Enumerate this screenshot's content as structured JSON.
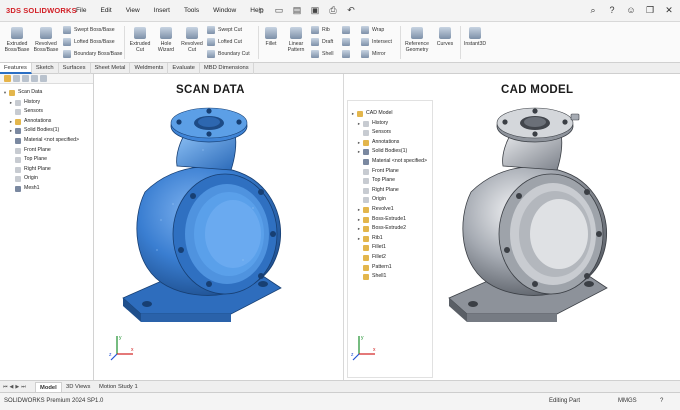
{
  "app": {
    "brand_prefix": "3DS",
    "brand": "SOLIDWORKS"
  },
  "menu": [
    "File",
    "Edit",
    "View",
    "Insert",
    "Tools",
    "Window",
    "Help"
  ],
  "quick_access_icons": [
    "home-icon",
    "new-icon",
    "open-icon",
    "save-icon",
    "print-icon",
    "undo-icon"
  ],
  "window_controls": [
    "search-icon",
    "help-icon",
    "user-icon",
    "restore-icon",
    "close-icon"
  ],
  "ribbon": {
    "extruded_boss": "Extruded Boss/Base",
    "revolved_boss": "Revolved Boss/Base",
    "swept_boss": "Swept Boss/Base",
    "lofted_boss": "Lofted Boss/Base",
    "boundary_boss": "Boundary Boss/Base",
    "extruded_cut": "Extruded Cut",
    "hole_wizard": "Hole Wizard",
    "revolved_cut": "Revolved Cut",
    "swept_cut": "Swept Cut",
    "lofted_cut": "Lofted Cut",
    "boundary_cut": "Boundary Cut",
    "fillet": "Fillet",
    "linear_pattern": "Linear Pattern",
    "rib": "Rib",
    "draft": "Draft",
    "shell": "Shell",
    "wrap": "Wrap",
    "intersect": "Intersect",
    "mirror": "Mirror",
    "reference_geometry": "Reference Geometry",
    "curves": "Curves",
    "instant3d": "Instant3D"
  },
  "tabs": [
    "Features",
    "Sketch",
    "Surfaces",
    "Sheet Metal",
    "Weldments",
    "Evaluate",
    "MBD Dimensions"
  ],
  "left_tree": {
    "root": "Scan Data",
    "items": [
      {
        "label": "History",
        "arrow": "▸",
        "icon": "w"
      },
      {
        "label": "Sensors",
        "arrow": "",
        "icon": "w"
      },
      {
        "label": "Annotations",
        "arrow": "▸",
        "icon": "y"
      },
      {
        "label": "Solid Bodies(1)",
        "arrow": "▸",
        "icon": "r"
      },
      {
        "label": "Material <not specified>",
        "arrow": "",
        "icon": "r"
      },
      {
        "label": "Front Plane",
        "arrow": "",
        "icon": "w"
      },
      {
        "label": "Top Plane",
        "arrow": "",
        "icon": "w"
      },
      {
        "label": "Right Plane",
        "arrow": "",
        "icon": "w"
      },
      {
        "label": "Origin",
        "arrow": "",
        "icon": "w"
      },
      {
        "label": "Mesh1",
        "arrow": "",
        "icon": "r"
      }
    ]
  },
  "right_tree": {
    "root": "CAD Model",
    "items": [
      {
        "label": "History",
        "arrow": "▸",
        "icon": "w"
      },
      {
        "label": "Sensors",
        "arrow": "",
        "icon": "w"
      },
      {
        "label": "Annotations",
        "arrow": "▸",
        "icon": "y"
      },
      {
        "label": "Solid Bodies(1)",
        "arrow": "▸",
        "icon": "r"
      },
      {
        "label": "Material <not specified>",
        "arrow": "",
        "icon": "r"
      },
      {
        "label": "Front Plane",
        "arrow": "",
        "icon": "w"
      },
      {
        "label": "Top Plane",
        "arrow": "",
        "icon": "w"
      },
      {
        "label": "Right Plane",
        "arrow": "",
        "icon": "w"
      },
      {
        "label": "Origin",
        "arrow": "",
        "icon": "w"
      },
      {
        "label": "Revolve1",
        "arrow": "▸",
        "icon": "y"
      },
      {
        "label": "Boss-Extrude1",
        "arrow": "▸",
        "icon": "y"
      },
      {
        "label": "Boss-Extrude2",
        "arrow": "▸",
        "icon": "y"
      },
      {
        "label": "Rib1",
        "arrow": "▸",
        "icon": "y"
      },
      {
        "label": "Fillet1",
        "arrow": "",
        "icon": "y"
      },
      {
        "label": "Fillet2",
        "arrow": "",
        "icon": "y"
      },
      {
        "label": "Pattern1",
        "arrow": "",
        "icon": "y"
      },
      {
        "label": "Shell1",
        "arrow": "",
        "icon": "y"
      }
    ]
  },
  "viewport": {
    "left_title": "SCAN DATA",
    "right_title": "CAD MODEL",
    "axis_labels": {
      "x": "x",
      "y": "y",
      "z": "z"
    },
    "scan_color": "#3a7ed1",
    "cad_color": "#9a9ea6"
  },
  "bottom_tabs": [
    "Model",
    "3D Views",
    "Motion Study 1"
  ],
  "status": {
    "version": "SOLIDWORKS Premium 2024 SP1.0",
    "mode": "Editing Part",
    "units": "MMGS"
  }
}
